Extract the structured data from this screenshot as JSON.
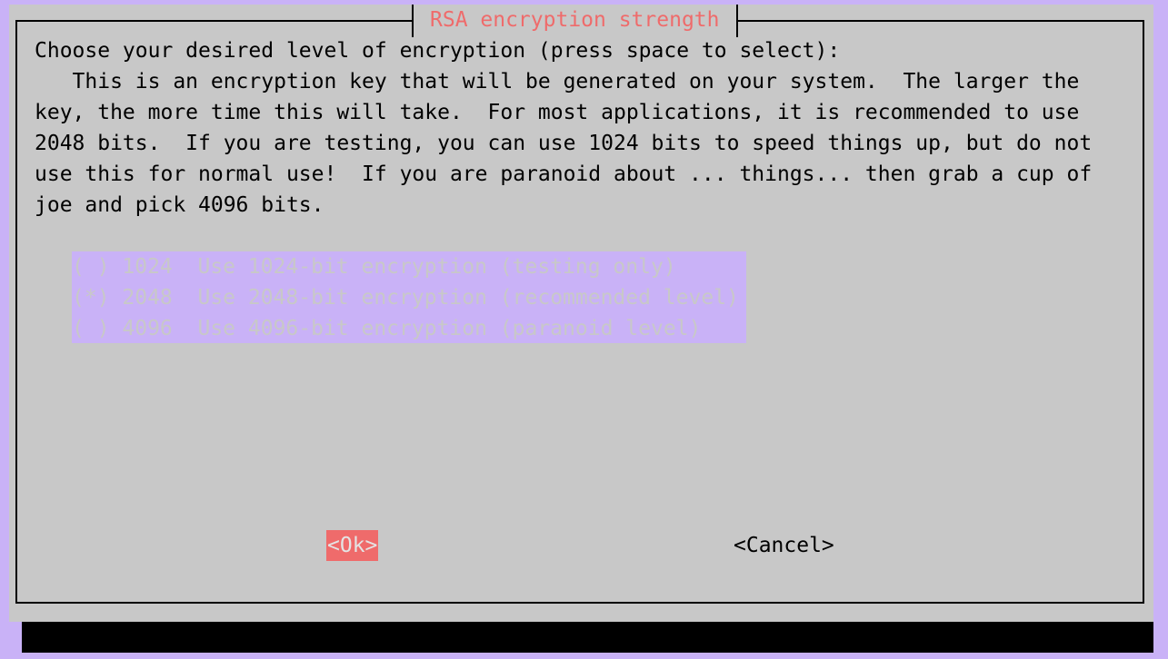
{
  "dialog": {
    "title": "RSA encryption strength",
    "prompt": "Choose your desired level of encryption (press space to select):\n   This is an encryption key that will be generated on your system.  The larger the\nkey, the more time this will take.  For most applications, it is recommended to use\n2048 bits.  If you are testing, you can use 1024 bits to speed things up, but do not\nuse this for normal use!  If you are paranoid about ... things... then grab a cup of\njoe and pick 4096 bits."
  },
  "options": [
    {
      "text": "( ) 1024  Use 1024-bit encryption (testing only)",
      "selected": false
    },
    {
      "text": "(*) 2048  Use 2048-bit encryption (recommended level)",
      "selected": true
    },
    {
      "text": "( ) 4096  Use 4096-bit encryption (paranoid level)",
      "selected": false
    }
  ],
  "buttons": {
    "ok": "<Ok>",
    "cancel": "<Cancel>"
  },
  "colors": {
    "background": "#c9b2f7",
    "dialog": "#c8c8c8",
    "title": "#ef6b6b",
    "focus": "#ef6b6b",
    "list_highlight": "#c9b2f7"
  }
}
